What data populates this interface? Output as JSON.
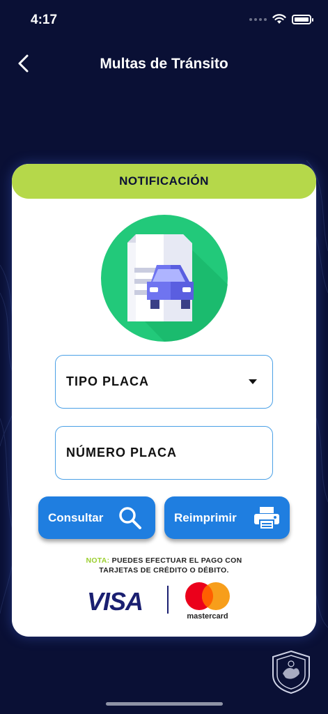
{
  "status": {
    "time": "4:17"
  },
  "nav": {
    "title": "Multas de Tránsito"
  },
  "card": {
    "header": "NOTIFICACIÓN",
    "tipo_placa": "TIPO PLACA",
    "numero_placa": "NÚMERO PLACA",
    "consultar": "Consultar",
    "reimprimir": "Reimprimir",
    "note_label": "NOTA:",
    "note_line1": "PUEDES EFECTUAR EL PAGO CON",
    "note_line2": "TARJETAS DE CRÉDITO O DÉBITO.",
    "visa": "VISA",
    "mastercard": "mastercard"
  },
  "colors": {
    "background": "#0a1035",
    "header_accent": "#b5d84a",
    "button": "#1f7ee0",
    "field_border": "#4aa0e6",
    "note_label": "#9bcf2f"
  },
  "icons": [
    "back-chevron-icon",
    "wifi-icon",
    "battery-icon",
    "document-car-icon",
    "search-icon",
    "printer-icon",
    "municipal-seal-icon"
  ]
}
